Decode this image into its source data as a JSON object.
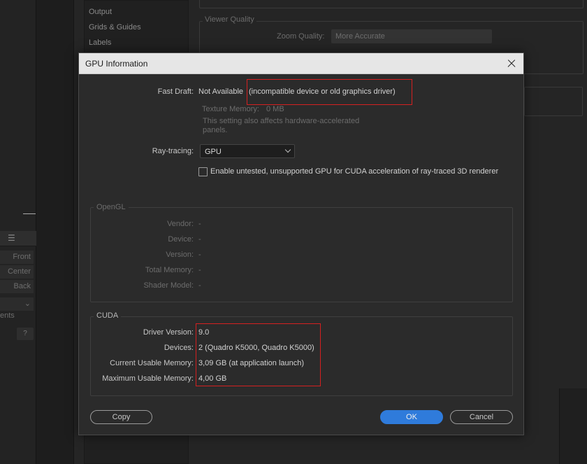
{
  "background": {
    "sidebar_items": [
      "Output",
      "Grids & Guides",
      "Labels"
    ],
    "viewer_quality_label": "Viewer Quality",
    "zoom_quality_label": "Zoom Quality:",
    "zoom_quality_value": "More Accurate",
    "view_buttons": [
      "Front",
      "Center",
      "Back"
    ],
    "side_text": "ents",
    "help_label": "?"
  },
  "dialog": {
    "title": "GPU Information",
    "fast_draft": {
      "label": "Fast Draft:",
      "status": "Not Available",
      "reason": "(incompatible device or old graphics driver)"
    },
    "texture_memory": {
      "label": "Texture Memory:",
      "value": "0 MB"
    },
    "setting_note_line1": "This setting also affects hardware-accelerated",
    "setting_note_line2": "panels.",
    "ray_tracing": {
      "label": "Ray-tracing:",
      "selected": "GPU"
    },
    "enable_untested_label": "Enable untested, unsupported GPU for CUDA acceleration of ray-traced 3D renderer",
    "opengl": {
      "title": "OpenGL",
      "rows": [
        {
          "label": "Vendor:",
          "value": "-"
        },
        {
          "label": "Device:",
          "value": "-"
        },
        {
          "label": "Version:",
          "value": "-"
        },
        {
          "label": "Total Memory:",
          "value": "-"
        },
        {
          "label": "Shader Model:",
          "value": "-"
        }
      ]
    },
    "cuda": {
      "title": "CUDA",
      "rows": [
        {
          "label": "Driver Version:",
          "value": "9.0"
        },
        {
          "label": "Devices:",
          "value": "2 (Quadro K5000, Quadro K5000)"
        },
        {
          "label": "Current Usable Memory:",
          "value": "3,09 GB (at application launch)"
        },
        {
          "label": "Maximum Usable Memory:",
          "value": "4,00 GB"
        }
      ]
    },
    "buttons": {
      "copy": "Copy",
      "ok": "OK",
      "cancel": "Cancel"
    }
  },
  "colors": {
    "highlight_box": "#d42020",
    "primary_button": "#2f7bdb",
    "dialog_bg": "#2b2b2b",
    "titlebar_bg": "#e6e6e6"
  }
}
